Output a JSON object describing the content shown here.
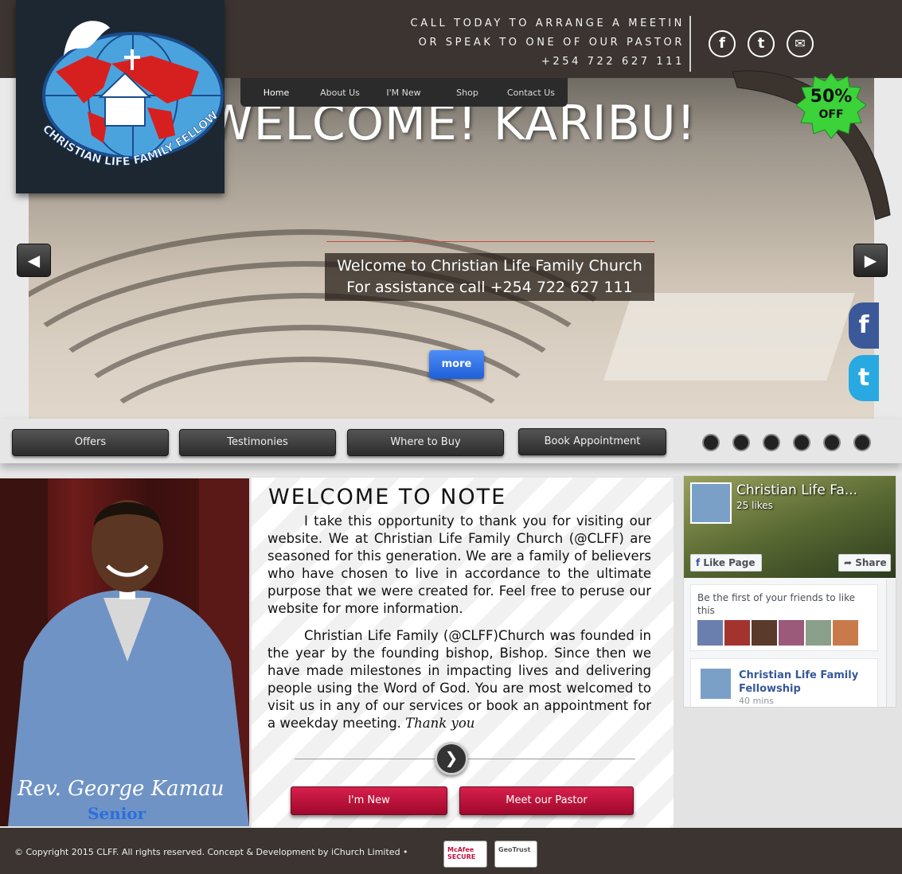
{
  "header": {
    "contact_line1": "CALL TODAY TO ARRANGE A MEETIN",
    "contact_line2": "OR SPEAK TO ONE OF OUR PASTOR",
    "contact_line3": "+254 722 627 111",
    "social": [
      {
        "name": "facebook-icon",
        "glyph": "f"
      },
      {
        "name": "twitter-icon",
        "glyph": "t"
      },
      {
        "name": "mail-icon",
        "glyph": "✉"
      }
    ]
  },
  "logo": {
    "text": "CHRISTIAN LIFE FAMILY FELLOWSHIP"
  },
  "nav": {
    "items": [
      "Home",
      "About Us",
      "I'M New",
      "Shop",
      "Contact Us"
    ]
  },
  "promo": {
    "percent": "50%",
    "off": "OFF"
  },
  "slider": {
    "title": "WELCOME! KARIBU!",
    "caption_line1": "Welcome to Christian Life Family Church",
    "caption_line2": "For assistance call +254 722 627 111",
    "more_label": "more",
    "prev_glyph": "◀",
    "next_glyph": "▶"
  },
  "side_social": {
    "facebook": "f",
    "twitter": "t"
  },
  "action_buttons": [
    "Offers",
    "Testimonies",
    "Where to Buy",
    "Book Appointment"
  ],
  "note": {
    "title": "WELCOME TO NOTE",
    "para1": "I take this opportunity to thank you for visiting our website. We at Christian  Life Family Church (@CLFF) are seasoned for this generation.  We are a family of believers who have chosen to live in accordance to the ultimate purpose that we were created for. Feel free to peruse our website for more information.",
    "para2": "Christian Life Family (@CLFF)Church was founded in the year by the founding bishop, Bishop. Since then we have made milestones in impacting lives and delivering people using the Word of God. You are most welcomed to visit us in any of our services or book an appointment for a weekday meeting.",
    "signoff": "Thank you",
    "next_glyph": "❯",
    "btn_new": "I'm New",
    "btn_pastor": "Meet our Pastor"
  },
  "pastor": {
    "name": "Rev. George Kamau",
    "title": "Senior"
  },
  "facebook_widget": {
    "page_name": "Christian Life Fa...",
    "likes": "25 likes",
    "like_btn": "Like Page",
    "share_btn": "Share",
    "friends_text": "Be the first of your friends to like this",
    "post_author": "Christian Life Family Fellowship",
    "post_time": "40 mins"
  },
  "footer": {
    "copyright": "© Copyright  2015  CLFF. All rights reserved. Concept & Development by iChurch  Limited •",
    "seal1": "McAfee SECURE",
    "seal2": "GeoTrust"
  },
  "colors": {
    "header_bg": "#3b3430",
    "accent_red": "#c4113f",
    "badge_green": "#36c72c",
    "fb_blue": "#3b5998",
    "twitter_blue": "#29a9e1"
  }
}
